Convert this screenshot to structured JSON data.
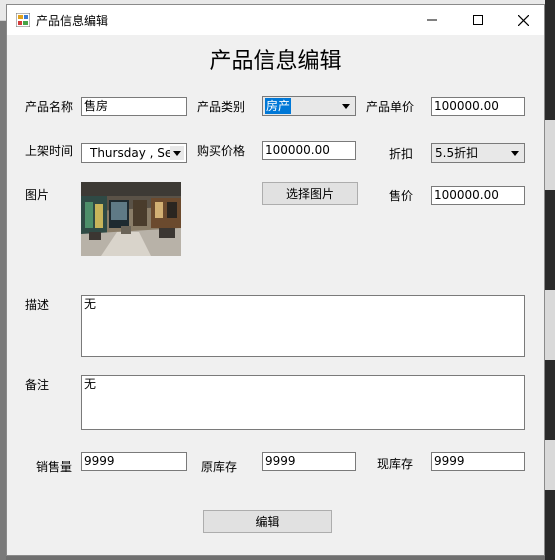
{
  "window": {
    "title": "产品信息编辑"
  },
  "form": {
    "heading": "产品信息编辑",
    "labels": {
      "product_name": "产品名称",
      "product_category": "产品类别",
      "unit_price": "产品单价",
      "listing_time": "上架时间",
      "purchase_price": "购买价格",
      "discount": "折扣",
      "image": "图片",
      "sale_price": "售价",
      "description": "描述",
      "remarks": "备注",
      "sales_volume": "销售量",
      "original_stock": "原库存",
      "current_stock": "现库存"
    },
    "values": {
      "product_name": "售房",
      "product_category": "房产",
      "unit_price": "100000.00",
      "listing_time": "Thursday  , Sept",
      "purchase_price": "100000.00",
      "discount": "5.5折扣",
      "sale_price": "100000.00",
      "description": "无",
      "remarks": "无",
      "sales_volume": "9999",
      "original_stock": "9999",
      "current_stock": "9999"
    },
    "buttons": {
      "choose_image": "选择图片",
      "edit": "编辑"
    }
  },
  "colors": {
    "selection": "#0078d7",
    "window_bg": "#f0f0f0",
    "button_bg": "#e1e1e1"
  }
}
